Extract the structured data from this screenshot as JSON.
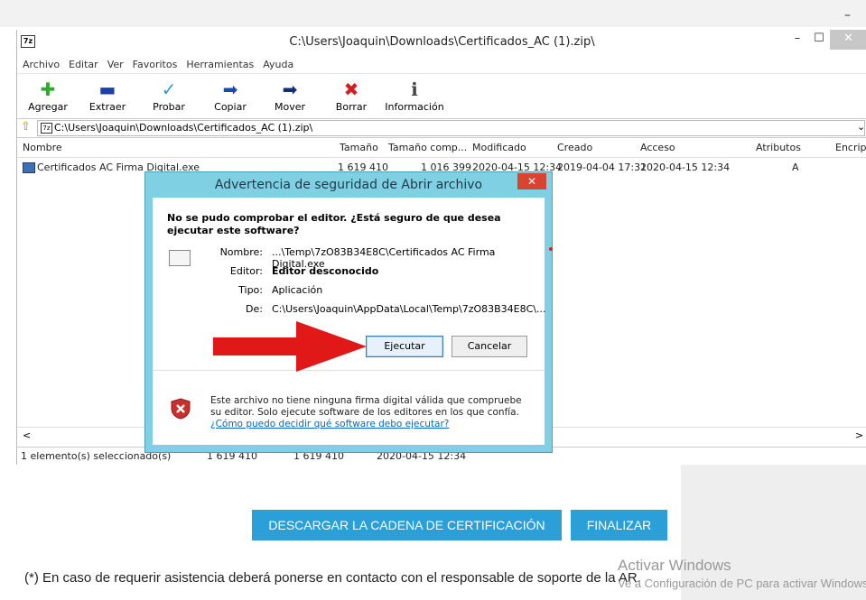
{
  "window": {
    "title": "C:\\Users\\Joaquin\\Downloads\\Certificados_AC (1).zip\\",
    "app_icon": "7z",
    "min_glyph": "–",
    "max_glyph": "☐",
    "close_glyph": "✕"
  },
  "menu": [
    "Archivo",
    "Editar",
    "Ver",
    "Favoritos",
    "Herramientas",
    "Ayuda"
  ],
  "toolbar": [
    {
      "label": "Agregar",
      "icon": "add-icon",
      "glyph": "✚",
      "color": "#2eaa2e"
    },
    {
      "label": "Extraer",
      "icon": "extract-icon",
      "glyph": "▬",
      "color": "#1d3fa8"
    },
    {
      "label": "Probar",
      "icon": "test-icon",
      "glyph": "✓",
      "color": "#2b9fc9"
    },
    {
      "label": "Copiar",
      "icon": "copy-icon",
      "glyph": "➡",
      "color": "#1d4aa8"
    },
    {
      "label": "Mover",
      "icon": "move-icon",
      "glyph": "➡",
      "color": "#122e7a"
    },
    {
      "label": "Borrar",
      "icon": "delete-icon",
      "glyph": "✖",
      "color": "#d02020"
    },
    {
      "label": "Información",
      "icon": "info-icon",
      "glyph": "ℹ",
      "color": "#444444"
    }
  ],
  "address": {
    "path": "C:\\Users\\Joaquin\\Downloads\\Certificados_AC (1).zip\\",
    "up_glyph": "⇧",
    "chevron": "⌄"
  },
  "columns": [
    "Nombre",
    "Tamaño",
    "Tamaño comp...",
    "Modificado",
    "Creado",
    "Acceso",
    "Atributos",
    "Encript"
  ],
  "file": {
    "name": "Certificados AC Firma Digital.exe",
    "size": "1 619 410",
    "packed": "1 016 399",
    "modified": "2020-04-15 12:34",
    "created": "2019-04-04 17:31",
    "accessed": "2020-04-15 12:34",
    "attributes": "A"
  },
  "scroll": {
    "left": "<",
    "right": ">"
  },
  "status": {
    "selected": "1 elemento(s) seleccionado(s)",
    "size": "1 619 410",
    "packed": "1 619 410",
    "date": "2020-04-15 12:34"
  },
  "dialog": {
    "title": "Advertencia de seguridad de Abrir archivo",
    "close_glyph": "✕",
    "question": "No se pudo comprobar el editor. ¿Está seguro de que desea ejecutar este software?",
    "name_label": "Nombre:",
    "name_value": "...\\Temp\\7zO83B34E8C\\Certificados AC Firma Digital.exe",
    "editor_label": "Editor:",
    "editor_value": "Editor desconocido",
    "type_label": "Tipo:",
    "type_value": "Aplicación",
    "from_label": "De:",
    "from_value": "C:\\Users\\Joaquin\\AppData\\Local\\Temp\\7zO83B34E8C\\...",
    "run_button": "Ejecutar",
    "cancel_button": "Cancelar",
    "warning_text": "Este archivo no tiene ninguna firma digital válida que compruebe su editor. Solo ejecute software de los editores en los que confía.",
    "warning_link": "¿Cómo puedo decidir qué software debo ejecutar?"
  },
  "page": {
    "download_button": "DESCARGAR LA CADENA DE CERTIFICACIÓN",
    "finish_button": "FINALIZAR",
    "notice": "(*) En caso de requerir asistencia deberá ponerse en contacto con el responsable de soporte de la AR.",
    "watermark_title": "Activar Windows",
    "watermark_sub": "Ve a Configuración de PC para activar Windows.",
    "outer_min_glyph": "–"
  },
  "colors": {
    "dialog_frame": "#7fd0e3",
    "button_blue": "#2a9fd8",
    "arrow_red": "#e01818"
  }
}
